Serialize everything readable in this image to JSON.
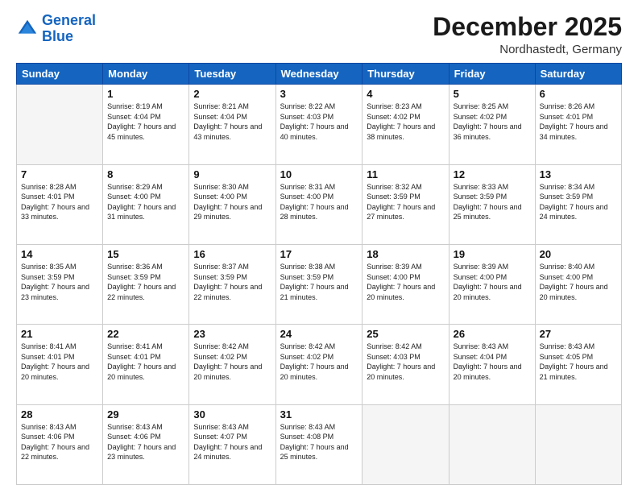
{
  "header": {
    "logo_line1": "General",
    "logo_line2": "Blue",
    "month": "December 2025",
    "location": "Nordhastedt, Germany"
  },
  "days_of_week": [
    "Sunday",
    "Monday",
    "Tuesday",
    "Wednesday",
    "Thursday",
    "Friday",
    "Saturday"
  ],
  "weeks": [
    [
      {
        "day": "",
        "empty": true
      },
      {
        "day": "1",
        "sunrise": "8:19 AM",
        "sunset": "4:04 PM",
        "daylight": "7 hours and 45 minutes."
      },
      {
        "day": "2",
        "sunrise": "8:21 AM",
        "sunset": "4:04 PM",
        "daylight": "7 hours and 43 minutes."
      },
      {
        "day": "3",
        "sunrise": "8:22 AM",
        "sunset": "4:03 PM",
        "daylight": "7 hours and 40 minutes."
      },
      {
        "day": "4",
        "sunrise": "8:23 AM",
        "sunset": "4:02 PM",
        "daylight": "7 hours and 38 minutes."
      },
      {
        "day": "5",
        "sunrise": "8:25 AM",
        "sunset": "4:02 PM",
        "daylight": "7 hours and 36 minutes."
      },
      {
        "day": "6",
        "sunrise": "8:26 AM",
        "sunset": "4:01 PM",
        "daylight": "7 hours and 34 minutes."
      }
    ],
    [
      {
        "day": "7",
        "sunrise": "8:28 AM",
        "sunset": "4:01 PM",
        "daylight": "7 hours and 33 minutes."
      },
      {
        "day": "8",
        "sunrise": "8:29 AM",
        "sunset": "4:00 PM",
        "daylight": "7 hours and 31 minutes."
      },
      {
        "day": "9",
        "sunrise": "8:30 AM",
        "sunset": "4:00 PM",
        "daylight": "7 hours and 29 minutes."
      },
      {
        "day": "10",
        "sunrise": "8:31 AM",
        "sunset": "4:00 PM",
        "daylight": "7 hours and 28 minutes."
      },
      {
        "day": "11",
        "sunrise": "8:32 AM",
        "sunset": "3:59 PM",
        "daylight": "7 hours and 27 minutes."
      },
      {
        "day": "12",
        "sunrise": "8:33 AM",
        "sunset": "3:59 PM",
        "daylight": "7 hours and 25 minutes."
      },
      {
        "day": "13",
        "sunrise": "8:34 AM",
        "sunset": "3:59 PM",
        "daylight": "7 hours and 24 minutes."
      }
    ],
    [
      {
        "day": "14",
        "sunrise": "8:35 AM",
        "sunset": "3:59 PM",
        "daylight": "7 hours and 23 minutes."
      },
      {
        "day": "15",
        "sunrise": "8:36 AM",
        "sunset": "3:59 PM",
        "daylight": "7 hours and 22 minutes."
      },
      {
        "day": "16",
        "sunrise": "8:37 AM",
        "sunset": "3:59 PM",
        "daylight": "7 hours and 22 minutes."
      },
      {
        "day": "17",
        "sunrise": "8:38 AM",
        "sunset": "3:59 PM",
        "daylight": "7 hours and 21 minutes."
      },
      {
        "day": "18",
        "sunrise": "8:39 AM",
        "sunset": "4:00 PM",
        "daylight": "7 hours and 20 minutes."
      },
      {
        "day": "19",
        "sunrise": "8:39 AM",
        "sunset": "4:00 PM",
        "daylight": "7 hours and 20 minutes."
      },
      {
        "day": "20",
        "sunrise": "8:40 AM",
        "sunset": "4:00 PM",
        "daylight": "7 hours and 20 minutes."
      }
    ],
    [
      {
        "day": "21",
        "sunrise": "8:41 AM",
        "sunset": "4:01 PM",
        "daylight": "7 hours and 20 minutes."
      },
      {
        "day": "22",
        "sunrise": "8:41 AM",
        "sunset": "4:01 PM",
        "daylight": "7 hours and 20 minutes."
      },
      {
        "day": "23",
        "sunrise": "8:42 AM",
        "sunset": "4:02 PM",
        "daylight": "7 hours and 20 minutes."
      },
      {
        "day": "24",
        "sunrise": "8:42 AM",
        "sunset": "4:02 PM",
        "daylight": "7 hours and 20 minutes."
      },
      {
        "day": "25",
        "sunrise": "8:42 AM",
        "sunset": "4:03 PM",
        "daylight": "7 hours and 20 minutes."
      },
      {
        "day": "26",
        "sunrise": "8:43 AM",
        "sunset": "4:04 PM",
        "daylight": "7 hours and 20 minutes."
      },
      {
        "day": "27",
        "sunrise": "8:43 AM",
        "sunset": "4:05 PM",
        "daylight": "7 hours and 21 minutes."
      }
    ],
    [
      {
        "day": "28",
        "sunrise": "8:43 AM",
        "sunset": "4:06 PM",
        "daylight": "7 hours and 22 minutes."
      },
      {
        "day": "29",
        "sunrise": "8:43 AM",
        "sunset": "4:06 PM",
        "daylight": "7 hours and 23 minutes."
      },
      {
        "day": "30",
        "sunrise": "8:43 AM",
        "sunset": "4:07 PM",
        "daylight": "7 hours and 24 minutes."
      },
      {
        "day": "31",
        "sunrise": "8:43 AM",
        "sunset": "4:08 PM",
        "daylight": "7 hours and 25 minutes."
      },
      {
        "day": "",
        "empty": true
      },
      {
        "day": "",
        "empty": true
      },
      {
        "day": "",
        "empty": true
      }
    ]
  ],
  "labels": {
    "sunrise": "Sunrise:",
    "sunset": "Sunset:",
    "daylight": "Daylight:"
  }
}
